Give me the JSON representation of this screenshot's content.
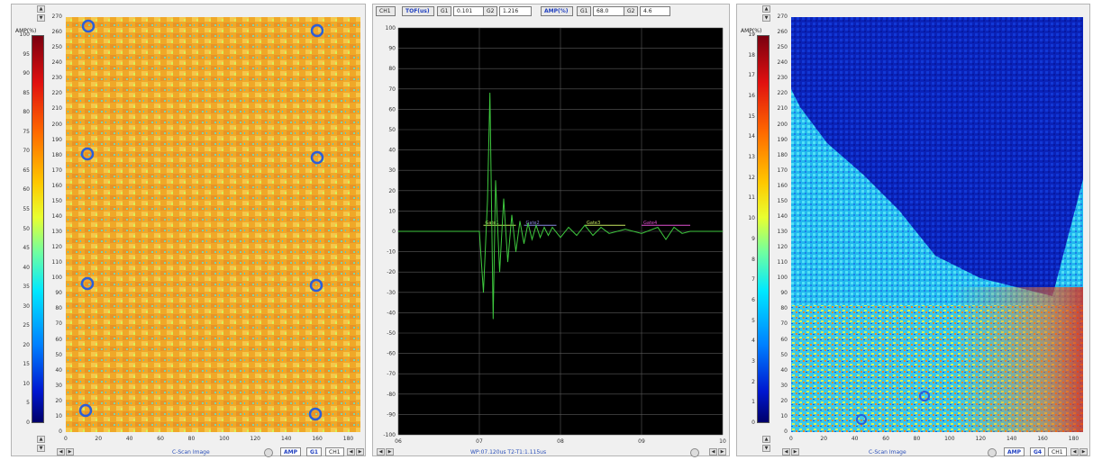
{
  "left_panel": {
    "amp_label": "AMP(%)",
    "color_scale_ticks": [
      "100",
      "95",
      "90",
      "85",
      "80",
      "75",
      "70",
      "65",
      "60",
      "55",
      "50",
      "45",
      "40",
      "35",
      "30",
      "25",
      "20",
      "15",
      "10",
      "5",
      "0"
    ],
    "y_axis_ticks": [
      "270",
      "260",
      "250",
      "240",
      "230",
      "220",
      "210",
      "200",
      "190",
      "180",
      "170",
      "160",
      "150",
      "140",
      "130",
      "120",
      "110",
      "100",
      "90",
      "80",
      "70",
      "60",
      "50",
      "40",
      "30",
      "20",
      "10",
      "0"
    ],
    "x_axis_ticks": [
      "0",
      "20",
      "40",
      "60",
      "80",
      "100",
      "120",
      "140",
      "160",
      "180"
    ],
    "footer_label": "C-Scan Image",
    "tabs": [
      "AMP",
      "G1",
      "CH1"
    ]
  },
  "middle_panel": {
    "header": {
      "channel": "CH1",
      "tof_label": "TOF(us)",
      "g1_label": "G1",
      "g1_value": "0.101",
      "g2_label": "G2",
      "g2_value": "1.216",
      "amp_label": "AMP(%)",
      "amp_g1_label": "G1",
      "amp_g1_value": "68.0",
      "amp_g2_label": "G2",
      "amp_g2_value": "4.6"
    },
    "footer_text": "WP:07.120us  T2-T1:1.115us",
    "gate_labels": [
      "Gate1",
      "Gate2",
      "Gate3",
      "Gate4"
    ],
    "chart_data": {
      "type": "line",
      "y_ticks": [
        "100",
        "90",
        "80",
        "70",
        "60",
        "50",
        "40",
        "30",
        "20",
        "10",
        "0",
        "-10",
        "-20",
        "-30",
        "-40",
        "-50",
        "-60",
        "-70",
        "-80",
        "-90",
        "-100"
      ],
      "x_ticks": [
        "06",
        "07",
        "08",
        "09",
        "10"
      ],
      "ylim": [
        -100,
        100
      ],
      "xlim": [
        6.0,
        10.0
      ],
      "series": [
        {
          "color": "#3ec93e",
          "x": [
            6.0,
            6.9,
            7.0,
            7.05,
            7.1,
            7.13,
            7.17,
            7.2,
            7.25,
            7.3,
            7.35,
            7.4,
            7.45,
            7.5,
            7.55,
            7.6,
            7.65,
            7.7,
            7.75,
            7.8,
            7.85,
            7.9,
            8.0,
            8.1,
            8.2,
            8.3,
            8.4,
            8.5,
            8.6,
            8.8,
            9.0,
            9.2,
            9.3,
            9.4,
            9.5,
            9.6,
            9.8,
            10.0
          ],
          "y": [
            0,
            0,
            0,
            -30,
            15,
            68,
            -43,
            25,
            -20,
            16,
            -15,
            8,
            -10,
            5,
            -6,
            4,
            -4,
            3,
            -3,
            2,
            -2,
            2,
            -3,
            2,
            -2,
            3,
            -2,
            2,
            -1,
            1,
            -1,
            2,
            -4,
            2,
            -1,
            0,
            0,
            0
          ]
        }
      ]
    }
  },
  "right_panel": {
    "amp_label": "AMP(%)",
    "color_scale_ticks": [
      "19",
      "18",
      "17",
      "16",
      "15",
      "14",
      "13",
      "12",
      "11",
      "10",
      "9",
      "8",
      "7",
      "6",
      "5",
      "4",
      "3",
      "2",
      "1",
      "0"
    ],
    "y_axis_ticks": [
      "270",
      "260",
      "250",
      "240",
      "230",
      "220",
      "210",
      "200",
      "190",
      "180",
      "170",
      "160",
      "150",
      "140",
      "130",
      "120",
      "110",
      "100",
      "90",
      "80",
      "70",
      "60",
      "50",
      "40",
      "30",
      "20",
      "10",
      "0"
    ],
    "x_axis_ticks": [
      "0",
      "20",
      "40",
      "60",
      "80",
      "100",
      "120",
      "140",
      "160",
      "180"
    ],
    "footer_label": "C-Scan Image",
    "tabs": [
      "AMP",
      "G4",
      "CH1"
    ]
  },
  "colors": {
    "scope_background": "#000000",
    "signal": "#3ec93e",
    "ui_accent": "#1f3fc0"
  }
}
